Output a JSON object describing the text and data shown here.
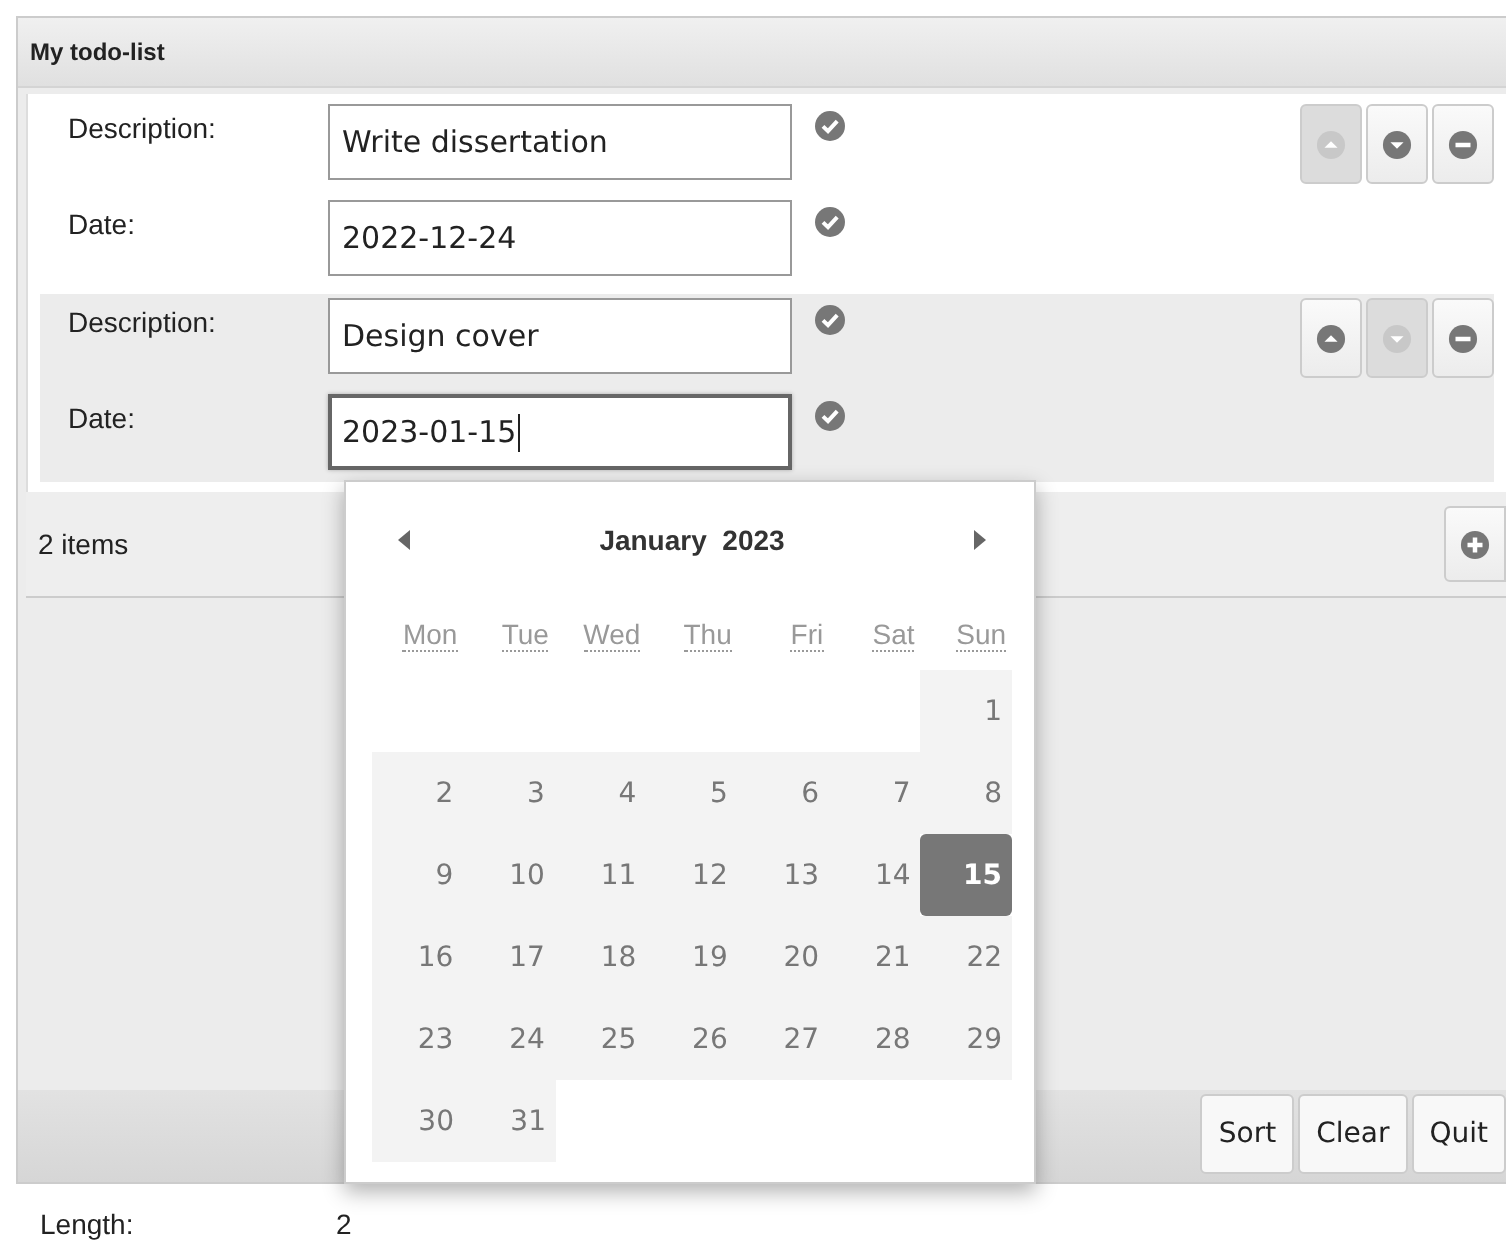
{
  "panel": {
    "title": "My todo-list"
  },
  "items": [
    {
      "fields": [
        {
          "label": "Description:",
          "value": "Write dissertation",
          "focused": false
        },
        {
          "label": "Date:",
          "value": "2022-12-24",
          "focused": false
        }
      ],
      "up_disabled": true,
      "down_disabled": false,
      "highlighted": false
    },
    {
      "fields": [
        {
          "label": "Description:",
          "value": "Design cover",
          "focused": false
        },
        {
          "label": "Date:",
          "value": "2023-01-15",
          "focused": true
        }
      ],
      "up_disabled": false,
      "down_disabled": true,
      "highlighted": true
    }
  ],
  "count": "2 items",
  "calendar": {
    "month": "January",
    "year": "2023",
    "weekdays": [
      "Mon",
      "Tue",
      "Wed",
      "Thu",
      "Fri",
      "Sat",
      "Sun"
    ],
    "weeks": [
      [
        {
          "day": "1",
          "selected": false
        }
      ],
      [
        {
          "day": "2",
          "selected": false
        },
        {
          "day": "3",
          "selected": false
        },
        {
          "day": "4",
          "selected": false
        },
        {
          "day": "5",
          "selected": false
        },
        {
          "day": "6",
          "selected": false
        },
        {
          "day": "7",
          "selected": false
        },
        {
          "day": "8",
          "selected": false
        }
      ],
      [
        {
          "day": "9",
          "selected": false
        },
        {
          "day": "10",
          "selected": false
        },
        {
          "day": "11",
          "selected": false
        },
        {
          "day": "12",
          "selected": false
        },
        {
          "day": "13",
          "selected": false
        },
        {
          "day": "14",
          "selected": false
        },
        {
          "day": "15",
          "selected": true
        }
      ],
      [
        {
          "day": "16",
          "selected": false
        },
        {
          "day": "17",
          "selected": false
        },
        {
          "day": "18",
          "selected": false
        },
        {
          "day": "19",
          "selected": false
        },
        {
          "day": "20",
          "selected": false
        },
        {
          "day": "21",
          "selected": false
        },
        {
          "day": "22",
          "selected": false
        }
      ],
      [
        {
          "day": "23",
          "selected": false
        },
        {
          "day": "24",
          "selected": false
        },
        {
          "day": "25",
          "selected": false
        },
        {
          "day": "26",
          "selected": false
        },
        {
          "day": "27",
          "selected": false
        },
        {
          "day": "28",
          "selected": false
        },
        {
          "day": "29",
          "selected": false
        }
      ],
      [
        {
          "day": "30",
          "selected": false
        },
        {
          "day": "31",
          "selected": false
        }
      ]
    ]
  },
  "buttons": [
    "Sort",
    "Clear",
    "Quit"
  ],
  "status": {
    "label": "Length:",
    "value": "2"
  }
}
